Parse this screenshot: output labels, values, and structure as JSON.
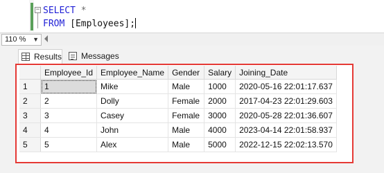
{
  "editor": {
    "line1": {
      "keyword": "SELECT",
      "rest": " *"
    },
    "line2": {
      "keyword": "FROM",
      "rest": " [Employees];"
    }
  },
  "zoom": {
    "value": "110 %"
  },
  "tabs": [
    {
      "label": "Results",
      "icon": "grid-icon"
    },
    {
      "label": "Messages",
      "icon": "messages-icon"
    }
  ],
  "grid": {
    "columns": [
      "Employee_Id",
      "Employee_Name",
      "Gender",
      "Salary",
      "Joining_Date"
    ],
    "rows": [
      {
        "n": "1",
        "cells": [
          "1",
          "Mike",
          "Male",
          "1000",
          "2020-05-16 22:01:17.637"
        ]
      },
      {
        "n": "2",
        "cells": [
          "2",
          "Dolly",
          "Female",
          "2000",
          "2017-04-23 22:01:29.603"
        ]
      },
      {
        "n": "3",
        "cells": [
          "3",
          "Casey",
          "Female",
          "3000",
          "2020-05-28 22:01:36.607"
        ]
      },
      {
        "n": "4",
        "cells": [
          "4",
          "John",
          "Male",
          "4000",
          "2023-04-14 22:01:58.937"
        ]
      },
      {
        "n": "5",
        "cells": [
          "5",
          "Alex",
          "Male",
          "5000",
          "2022-12-15 22:02:13.570"
        ]
      }
    ]
  },
  "colors": {
    "highlight_border": "#e53935",
    "keyword": "#1f1fd6",
    "change_bar": "#5aa05a"
  }
}
